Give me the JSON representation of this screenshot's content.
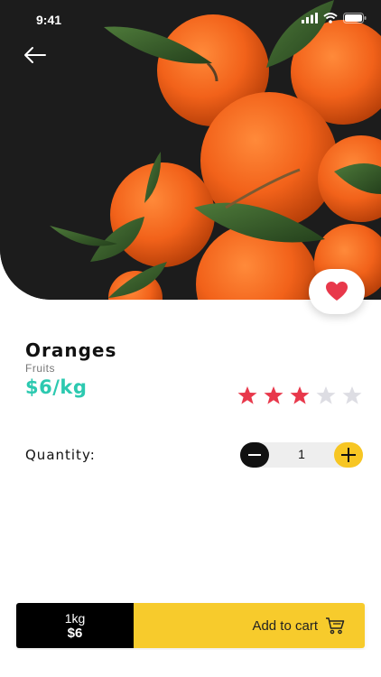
{
  "status_bar": {
    "time": "9:41",
    "icons": [
      "cellular-signal-icon",
      "wifi-icon",
      "battery-icon"
    ]
  },
  "header": {
    "back_icon": "arrow-left-icon"
  },
  "product": {
    "image": "oranges-photo",
    "favorite_icon": "heart-icon",
    "name": "Oranges",
    "category": "Fruits",
    "price": "$6/kg",
    "rating": 3,
    "rating_max": 5
  },
  "quantity": {
    "label": "Quantity:",
    "value": "1",
    "decrement_icon": "minus-icon",
    "increment_icon": "plus-icon"
  },
  "cart": {
    "weight": "1kg",
    "total": "$6",
    "button_label": "Add to cart",
    "cart_icon": "shopping-cart-icon"
  },
  "colors": {
    "price": "#2cc9b0",
    "accent_yellow": "#f7c623",
    "star_filled": "#e8384b",
    "star_empty": "#dddde3",
    "heart": "#e8384b"
  }
}
